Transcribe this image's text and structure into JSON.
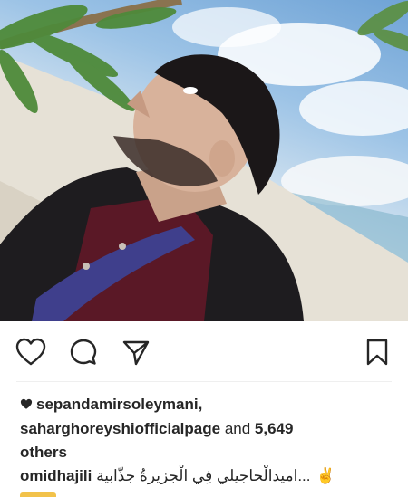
{
  "post": {
    "image_alt": "Man with beard looking upward in front of a tropical beach backdrop"
  },
  "actions": {
    "like_icon": "heart-outline-icon",
    "comment_icon": "comment-bubble-icon",
    "share_icon": "paper-plane-icon",
    "save_icon": "bookmark-icon"
  },
  "likes": {
    "user1": "sepandamirsoleymani,",
    "user2": "saharghoreyshiofficialpage",
    "connector": "and",
    "count": "5,649",
    "suffix": "others"
  },
  "caption": {
    "username": "omidhajili",
    "text": "...اميدالْحاجيلي فِي الْجزيرةُ جذّابية",
    "emoji": "✌"
  },
  "colors": {
    "text": "#262626",
    "divider": "#efefef",
    "sky": "#9cc3e6"
  }
}
